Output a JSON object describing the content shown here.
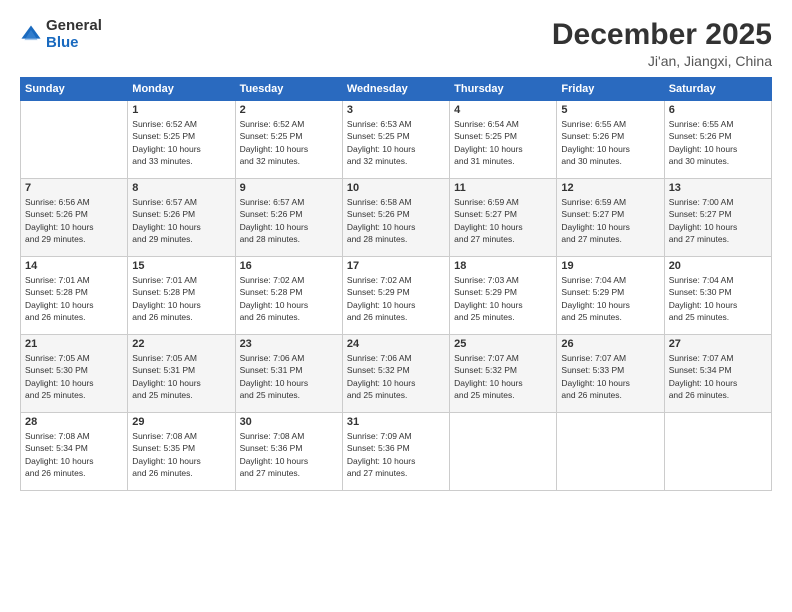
{
  "logo": {
    "general": "General",
    "blue": "Blue"
  },
  "header": {
    "month": "December 2025",
    "location": "Ji'an, Jiangxi, China"
  },
  "weekdays": [
    "Sunday",
    "Monday",
    "Tuesday",
    "Wednesday",
    "Thursday",
    "Friday",
    "Saturday"
  ],
  "weeks": [
    [
      {
        "day": "",
        "info": ""
      },
      {
        "day": "1",
        "info": "Sunrise: 6:52 AM\nSunset: 5:25 PM\nDaylight: 10 hours\nand 33 minutes."
      },
      {
        "day": "2",
        "info": "Sunrise: 6:52 AM\nSunset: 5:25 PM\nDaylight: 10 hours\nand 32 minutes."
      },
      {
        "day": "3",
        "info": "Sunrise: 6:53 AM\nSunset: 5:25 PM\nDaylight: 10 hours\nand 32 minutes."
      },
      {
        "day": "4",
        "info": "Sunrise: 6:54 AM\nSunset: 5:25 PM\nDaylight: 10 hours\nand 31 minutes."
      },
      {
        "day": "5",
        "info": "Sunrise: 6:55 AM\nSunset: 5:26 PM\nDaylight: 10 hours\nand 30 minutes."
      },
      {
        "day": "6",
        "info": "Sunrise: 6:55 AM\nSunset: 5:26 PM\nDaylight: 10 hours\nand 30 minutes."
      }
    ],
    [
      {
        "day": "7",
        "info": "Sunrise: 6:56 AM\nSunset: 5:26 PM\nDaylight: 10 hours\nand 29 minutes."
      },
      {
        "day": "8",
        "info": "Sunrise: 6:57 AM\nSunset: 5:26 PM\nDaylight: 10 hours\nand 29 minutes."
      },
      {
        "day": "9",
        "info": "Sunrise: 6:57 AM\nSunset: 5:26 PM\nDaylight: 10 hours\nand 28 minutes."
      },
      {
        "day": "10",
        "info": "Sunrise: 6:58 AM\nSunset: 5:26 PM\nDaylight: 10 hours\nand 28 minutes."
      },
      {
        "day": "11",
        "info": "Sunrise: 6:59 AM\nSunset: 5:27 PM\nDaylight: 10 hours\nand 27 minutes."
      },
      {
        "day": "12",
        "info": "Sunrise: 6:59 AM\nSunset: 5:27 PM\nDaylight: 10 hours\nand 27 minutes."
      },
      {
        "day": "13",
        "info": "Sunrise: 7:00 AM\nSunset: 5:27 PM\nDaylight: 10 hours\nand 27 minutes."
      }
    ],
    [
      {
        "day": "14",
        "info": "Sunrise: 7:01 AM\nSunset: 5:28 PM\nDaylight: 10 hours\nand 26 minutes."
      },
      {
        "day": "15",
        "info": "Sunrise: 7:01 AM\nSunset: 5:28 PM\nDaylight: 10 hours\nand 26 minutes."
      },
      {
        "day": "16",
        "info": "Sunrise: 7:02 AM\nSunset: 5:28 PM\nDaylight: 10 hours\nand 26 minutes."
      },
      {
        "day": "17",
        "info": "Sunrise: 7:02 AM\nSunset: 5:29 PM\nDaylight: 10 hours\nand 26 minutes."
      },
      {
        "day": "18",
        "info": "Sunrise: 7:03 AM\nSunset: 5:29 PM\nDaylight: 10 hours\nand 25 minutes."
      },
      {
        "day": "19",
        "info": "Sunrise: 7:04 AM\nSunset: 5:29 PM\nDaylight: 10 hours\nand 25 minutes."
      },
      {
        "day": "20",
        "info": "Sunrise: 7:04 AM\nSunset: 5:30 PM\nDaylight: 10 hours\nand 25 minutes."
      }
    ],
    [
      {
        "day": "21",
        "info": "Sunrise: 7:05 AM\nSunset: 5:30 PM\nDaylight: 10 hours\nand 25 minutes."
      },
      {
        "day": "22",
        "info": "Sunrise: 7:05 AM\nSunset: 5:31 PM\nDaylight: 10 hours\nand 25 minutes."
      },
      {
        "day": "23",
        "info": "Sunrise: 7:06 AM\nSunset: 5:31 PM\nDaylight: 10 hours\nand 25 minutes."
      },
      {
        "day": "24",
        "info": "Sunrise: 7:06 AM\nSunset: 5:32 PM\nDaylight: 10 hours\nand 25 minutes."
      },
      {
        "day": "25",
        "info": "Sunrise: 7:07 AM\nSunset: 5:32 PM\nDaylight: 10 hours\nand 25 minutes."
      },
      {
        "day": "26",
        "info": "Sunrise: 7:07 AM\nSunset: 5:33 PM\nDaylight: 10 hours\nand 26 minutes."
      },
      {
        "day": "27",
        "info": "Sunrise: 7:07 AM\nSunset: 5:34 PM\nDaylight: 10 hours\nand 26 minutes."
      }
    ],
    [
      {
        "day": "28",
        "info": "Sunrise: 7:08 AM\nSunset: 5:34 PM\nDaylight: 10 hours\nand 26 minutes."
      },
      {
        "day": "29",
        "info": "Sunrise: 7:08 AM\nSunset: 5:35 PM\nDaylight: 10 hours\nand 26 minutes."
      },
      {
        "day": "30",
        "info": "Sunrise: 7:08 AM\nSunset: 5:36 PM\nDaylight: 10 hours\nand 27 minutes."
      },
      {
        "day": "31",
        "info": "Sunrise: 7:09 AM\nSunset: 5:36 PM\nDaylight: 10 hours\nand 27 minutes."
      },
      {
        "day": "",
        "info": ""
      },
      {
        "day": "",
        "info": ""
      },
      {
        "day": "",
        "info": ""
      }
    ]
  ]
}
